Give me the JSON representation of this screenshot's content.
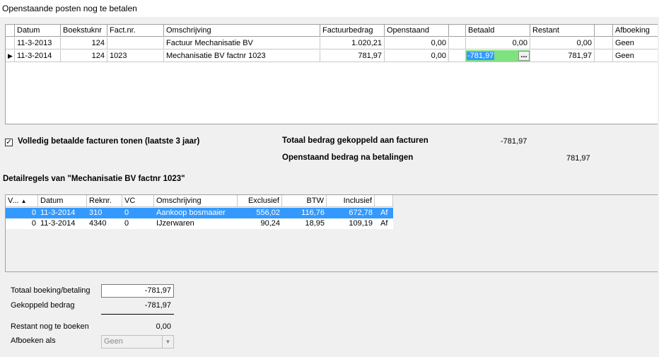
{
  "window": {
    "title": "Openstaande posten nog te betalen"
  },
  "invoices": {
    "columns": [
      "Datum",
      "Boekstuknr",
      "Fact.nr.",
      "Omschrijving",
      "Factuurbedrag",
      "Openstaand",
      "",
      "Betaald",
      "Restant",
      "",
      "Afboeking"
    ],
    "rows": [
      {
        "datum": "11-3-2013",
        "boekstuknr": "124",
        "factnr": "",
        "omschrijving": "Factuur Mechanisatie BV",
        "factuurbedrag": "1.020,21",
        "openstaand": "0,00",
        "betaald": "0,00",
        "restant": "0,00",
        "afboeking": "Geen"
      },
      {
        "datum": "11-3-2014",
        "boekstuknr": "124",
        "factnr": "1023",
        "omschrijving": "Mechanisatie BV factnr 1023",
        "factuurbedrag": "781,97",
        "openstaand": "0,00",
        "betaald": "-781,97",
        "restant": "781,97",
        "afboeking": "Geen"
      }
    ],
    "row_indicator": "▶",
    "ellipsis_label": "..."
  },
  "options": {
    "show_paid_label": "Volledig betaalde facturen tonen (laatste 3 jaar)",
    "show_paid_checked": true,
    "check_mark": "✓"
  },
  "totals": {
    "linked_label": "Totaal bedrag gekoppeld aan facturen",
    "linked_value": "-781,97",
    "open_label": "Openstaand bedrag na betalingen",
    "open_value": "781,97"
  },
  "detail": {
    "title": "Detailregels van \"Mechanisatie BV factnr 1023\"",
    "columns": [
      "V...",
      "Datum",
      "Reknr.",
      "VC",
      "Omschrijving",
      "Exclusief",
      "BTW",
      "Inclusief",
      ""
    ],
    "sort_glyph": "▲",
    "rows": [
      {
        "v": "0",
        "datum": "11-3-2014",
        "reknr": "310",
        "vc": "0",
        "omschrijving": "Aankoop bosmaaier",
        "exclusief": "556,02",
        "btw": "116,76",
        "inclusief": "672,78",
        "af": "Af"
      },
      {
        "v": "0",
        "datum": "11-3-2014",
        "reknr": "4340",
        "vc": "0",
        "omschrijving": "IJzerwaren",
        "exclusief": "90,24",
        "btw": "18,95",
        "inclusief": "109,19",
        "af": "Af"
      }
    ]
  },
  "summary": {
    "total_label": "Totaal boeking/betaling",
    "total_value": "-781,97",
    "linked_label": "Gekoppeld bedrag",
    "linked_value": "-781,97",
    "remaining_label": "Restant nog te boeken",
    "remaining_value": "0,00",
    "writeoff_label": "Afboeken als",
    "writeoff_value": "Geen",
    "dropdown_glyph": "▼"
  },
  "colors": {
    "selection": "#3399ff",
    "edit_cell": "#7ee27e"
  }
}
